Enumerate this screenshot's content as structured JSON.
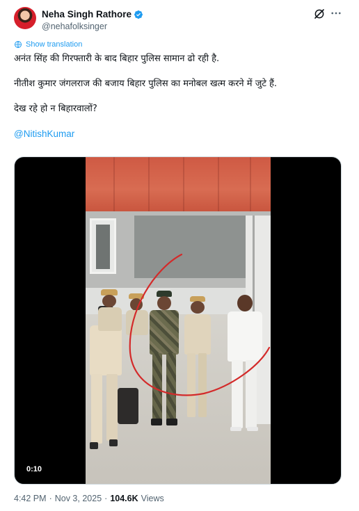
{
  "author": {
    "display_name": "Neha Singh Rathore",
    "handle": "@nehafolksinger",
    "verified": true
  },
  "actions": {
    "grok_icon": "grok-icon",
    "more_icon": "more-icon"
  },
  "translation": {
    "label": "Show translation"
  },
  "tweet": {
    "lines": [
      "अनंत सिंह की गिरफ्तारी के बाद बिहार पुलिस सामान ढो रही है.",
      "नीतीश कुमार जंगलराज की बजाय बिहार पुलिस का मनोबल खत्म करने में जुटे हैं.",
      "देख रहे हो न बिहारवालों?"
    ],
    "mention": "@NitishKumar"
  },
  "media": {
    "type": "video",
    "duration": "0:10"
  },
  "meta": {
    "time": "4:42 PM",
    "separator": "·",
    "date": "Nov 3, 2025",
    "views_count": "104.6K",
    "views_label": "Views"
  },
  "colors": {
    "accent": "#1d9bf0",
    "text": "#0f1419",
    "muted": "#536471",
    "annotation": "#d32a2a"
  }
}
